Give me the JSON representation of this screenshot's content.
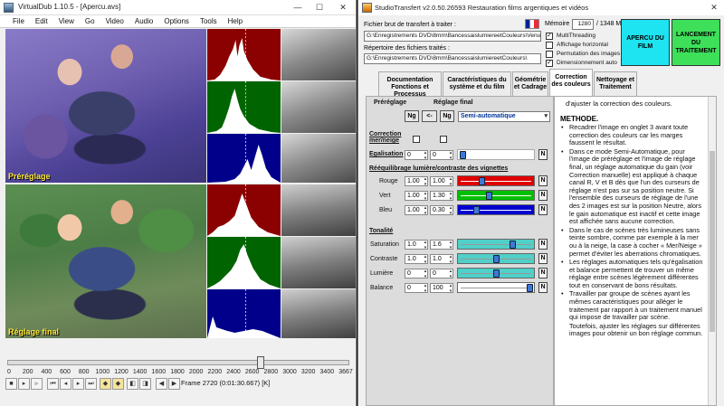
{
  "virtualdub": {
    "title": "VirtualDub 1.10.5 - [Apercu.avs]",
    "menu": [
      "File",
      "Edit",
      "View",
      "Go",
      "Video",
      "Audio",
      "Options",
      "Tools",
      "Help"
    ],
    "pane_labels": {
      "top": "Préréglage",
      "bottom": "Réglage final"
    },
    "timeline": {
      "ticks": [
        "0",
        "200",
        "400",
        "600",
        "800",
        "1000",
        "1200",
        "1400",
        "1600",
        "1800",
        "2000",
        "2200",
        "2400",
        "2600",
        "2800",
        "3000",
        "3200",
        "3400",
        "3667"
      ],
      "position": 2720,
      "total": 3667
    },
    "frame_readout": "Frame 2720 (0:01:30.667) [K]"
  },
  "studiotransfert": {
    "title": "StudioTransfert v2.0.50.26593 Restauration films argentiques et vidéos",
    "source_label": "Fichier brut de transfert à traiter :",
    "source_path": "G:\\Enregistrements DVD\\8mm\\BancessaislumiereetCouleurs\\VenuDa",
    "dest_label": "Répertoire des fichiers traités :",
    "dest_path": "G:\\Enregistrements DVD\\8mm\\BancessaislumiereetCouleurs\\",
    "memory_label": "Mémoire",
    "memory_value": "1280",
    "memory_total": "/ 1348 Mo",
    "options": [
      {
        "label": "MultiThreading",
        "checked": true
      },
      {
        "label": "Affichage horizontal",
        "checked": false
      },
      {
        "label": "Permutation des images",
        "checked": false
      },
      {
        "label": "Dimensionnement auto",
        "checked": true
      }
    ],
    "preview_button": "APERCU DU FILM",
    "launch_button": "LANCEMENT DU TRAITEMENT",
    "tabs": [
      {
        "label": "Documentation Fonctions et Processus",
        "active": false
      },
      {
        "label": "Caractéristiques du système et du film",
        "active": false
      },
      {
        "label": "Géométrie et Cadrage",
        "active": false
      },
      {
        "label": "Correction des couleurs",
        "active": true
      },
      {
        "label": "Nettoyage et Traitement",
        "active": false
      }
    ],
    "panel": {
      "prereglage": "Préréglage",
      "reglage_final": "Réglage final",
      "btn_ng": "Ng",
      "btn_arrow": "<-",
      "mode": "Semi-automatique",
      "correction_label": "Correction mer/neige",
      "egalisation_label": "Egalisation",
      "egalisation_pre": "0",
      "egalisation_final": "0",
      "egalisation_level": 0.03,
      "reequilibrage_title": "Rééquilibrage lumière/contraste des vignettes",
      "rows": [
        {
          "label": "Rouge",
          "pre": "1.00",
          "final": "1.00",
          "level": 0.3,
          "color": "#e00000"
        },
        {
          "label": "Vert",
          "pre": "1.00",
          "final": "1.30",
          "level": 0.4,
          "color": "#00c000"
        },
        {
          "label": "Bleu",
          "pre": "1.00",
          "final": "0.30",
          "level": 0.22,
          "color": "#0000d0"
        }
      ],
      "tonalite_title": "Tonalité",
      "tonal_rows": [
        {
          "label": "Saturation",
          "pre": "1.0",
          "final": "1.6",
          "level": 0.73,
          "color": "#4fd0c8"
        },
        {
          "label": "Contraste",
          "pre": "1.0",
          "final": "1.0",
          "level": 0.5,
          "color": "#4fd0c8"
        },
        {
          "label": "Lumière",
          "pre": "0",
          "final": "0",
          "level": 0.5,
          "color": "#4fd0c8"
        },
        {
          "label": "Balance",
          "pre": "0",
          "final": "100",
          "level": 0.97,
          "color": "#ffffff"
        }
      ],
      "n_label": "N"
    },
    "help": {
      "intro": "d'ajuster la correction des couleurs.",
      "heading": "METHODE.",
      "items": [
        "Recadrer l'image en onglet 3 avant toute correction des couleurs car les marges faussent le résultat.",
        "Dans ce mode Semi-Automatique, pour l'image de préréglage et l'image de réglage final, un réglage automatique du gain (voir Correction manuelle) est appliqué à chaque canal R, V et B dès que l'un des curseurs de réglage n'est pas sur sa position neutre. Si l'ensemble des curseurs de réglage de l'une des 2 images est sur la position Neutre, alors le gain automatique est inactif et cette image est affichée sans aucune correction.",
        "Dans le cas de scènes très lumineuses sans teinte sombre, comme par exemple à la mer ou à la neige, la case à cocher « Mer/Neige » permet d'éviter les aberrations chromatiques.",
        "Les réglages automatiques tels qu'égalisation et balance permettent de trouver un même réglage entre scènes légèrement différentes tout en conservant de bons résultats.",
        "Travailler par groupe de scènes ayant les mêmes caractéristiques pour alléger le traitement par rapport à un traitement manuel qui impose de travailler par scène."
      ],
      "continuation": "Toutefois, ajuster les réglages sur différentes images pour obtenir un bon réglage commun."
    }
  }
}
